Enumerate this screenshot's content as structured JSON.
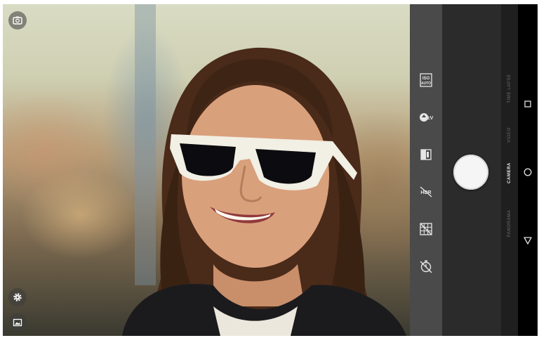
{
  "app": {
    "name": "Camera"
  },
  "viewfinder": {
    "top_icons": [
      "camera-switch-icon"
    ],
    "bottom_icons": [
      "settings-gear-icon",
      "gallery-icon"
    ]
  },
  "settings_strip": {
    "items": [
      {
        "icon": "iso-auto-icon",
        "label": "ISO AUTO"
      },
      {
        "icon": "exposure-compensation-icon",
        "label": ""
      },
      {
        "icon": "white-balance-icon",
        "label": ""
      },
      {
        "icon": "hdr-off-icon",
        "label": ""
      },
      {
        "icon": "grid-icon",
        "label": ""
      },
      {
        "icon": "timer-icon",
        "label": ""
      }
    ],
    "iso_line1": "ISO",
    "iso_line2": "AUTO",
    "exposure_label": "±V"
  },
  "modes": {
    "items": [
      "TIME LAPSE",
      "VIDEO",
      "CAMERA",
      "PANORAMA"
    ],
    "active": "CAMERA"
  },
  "nav": {
    "items": [
      "recents-square-icon",
      "home-circle-icon",
      "back-triangle-icon"
    ]
  },
  "colors": {
    "strip": "#4a4a4a",
    "shutter_area": "#2b2b2b",
    "mode_strip": "#1f1f1f",
    "nav": "#000000",
    "shutter": "#f5f5f5"
  }
}
